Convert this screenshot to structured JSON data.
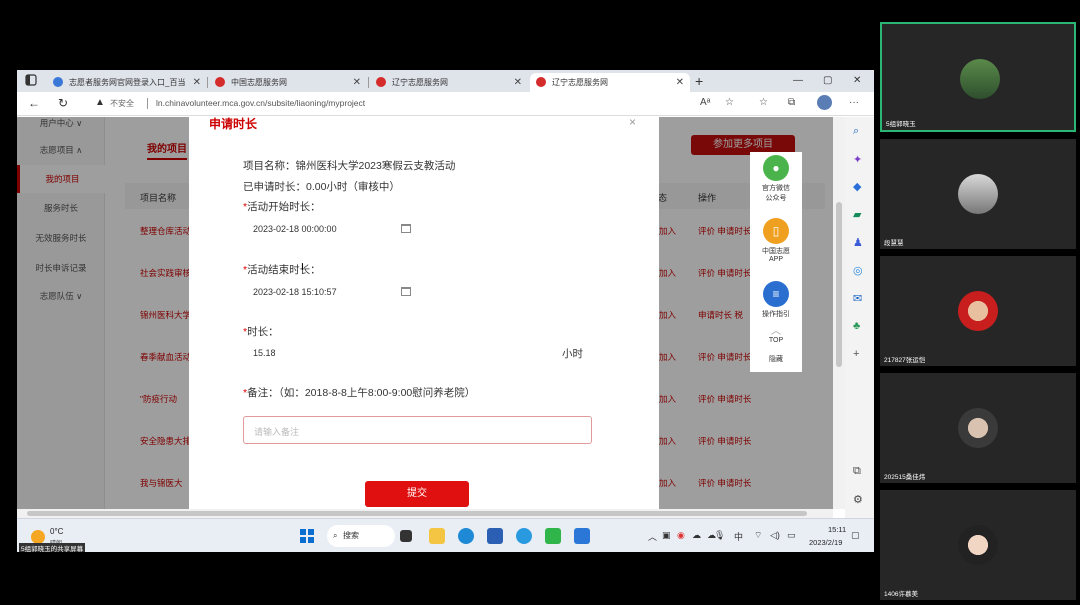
{
  "browser": {
    "tabs": [
      {
        "title": "志愿者服务网官网登录入口_百当",
        "active": false
      },
      {
        "title": "中国志愿服务网",
        "active": false
      },
      {
        "title": "辽宁志愿服务网",
        "active": false
      },
      {
        "title": "辽宁志愿服务网",
        "active": true
      }
    ],
    "new_tab": "+",
    "security_label": "不安全",
    "url": "ln.chinavolunteer.mca.gov.cn/subsite/liaoning/myproject"
  },
  "sidebar": {
    "items": [
      {
        "label": "用户中心 ∨"
      },
      {
        "label": "志愿项目 ∧"
      },
      {
        "label": "我的项目"
      },
      {
        "label": "服务时长"
      },
      {
        "label": "无效服务时长"
      },
      {
        "label": "时长申诉记录"
      },
      {
        "label": "志愿队伍 ∨"
      }
    ]
  },
  "main": {
    "section_title": "我的项目",
    "join_button": "参加更多项目",
    "col_name": "项目名称",
    "col_status": "状态",
    "col_action": "操作",
    "rows": [
      {
        "name": "整理仓库活动",
        "status": "加入",
        "actions": "评价  申请时长"
      },
      {
        "name": "社会实践审核",
        "status": "加入",
        "actions": "评价  申请时长"
      },
      {
        "name": "锦州医科大学",
        "status": "加入",
        "actions": "申请时长  税"
      },
      {
        "name": "春季献血活动",
        "status": "加入",
        "actions": "评价  申请时长"
      },
      {
        "name": "\"防疫行动",
        "status": "加入",
        "actions": "评价  申请时长"
      },
      {
        "name": "安全隐患大排",
        "status": "加入",
        "actions": "评价  申请时长"
      },
      {
        "name": "我与锦医大",
        "status": "加入",
        "actions": "评价  申请时长"
      }
    ]
  },
  "floatbar": {
    "wechat": "官方微信\n公众号",
    "app": "中国志愿\nAPP",
    "guide": "操作指引",
    "top": "TOP",
    "hide": "隐藏"
  },
  "modal": {
    "title": "申请时长",
    "close": "×",
    "project_name": "项目名称：锦州医科大学2023寒假云支教活动",
    "applied_hours": "已申请时长：0.00小时（审核中）",
    "start_label": "活动开始时长：",
    "start_value": "2023-02-18 00:00:00",
    "end_label": "活动结束时长：",
    "end_value": "2023-02-18 15:10:57",
    "hours_label": "时长：",
    "hours_value": "15.18",
    "hours_unit": "小时",
    "remark_label": "备注：（如：2018-8-8上午8:00-9:00慰问养老院）",
    "remark_placeholder": "请输入备注",
    "submit": "提交",
    "required_mark": "*"
  },
  "taskbar": {
    "temperature": "0°C",
    "weather": "晴朗",
    "share_label": "5组郭晓玉的共享屏幕",
    "search": "搜索",
    "ime": "中",
    "time": "15:11",
    "date": "2023/2/19"
  },
  "participants": [
    {
      "name": "5组郭晓玉"
    },
    {
      "name": "段慧慧"
    },
    {
      "name": "217827张运恺"
    },
    {
      "name": "202515桑佳炜"
    },
    {
      "name": "1406许慕美"
    }
  ]
}
